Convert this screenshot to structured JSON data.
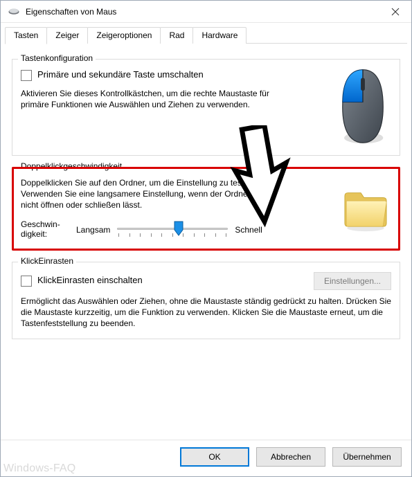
{
  "window": {
    "title": "Eigenschaften von Maus"
  },
  "tabs": [
    {
      "label": "Tasten",
      "active": true
    },
    {
      "label": "Zeiger",
      "active": false
    },
    {
      "label": "Zeigeroptionen",
      "active": false
    },
    {
      "label": "Rad",
      "active": false
    },
    {
      "label": "Hardware",
      "active": false
    }
  ],
  "group_button_config": {
    "legend": "Tastenkonfiguration",
    "checkbox_label": "Primäre und sekundäre Taste umschalten",
    "description": "Aktivieren Sie dieses Kontrollkästchen, um die rechte Maustaste für primäre Funktionen wie Auswählen und Ziehen zu verwenden."
  },
  "group_doubleclick": {
    "legend": "Doppelklickgeschwindigkeit",
    "description": "Doppelklicken Sie auf den Ordner, um die Einstellung zu testen. Verwenden Sie eine langsamere Einstellung, wenn der Ordner sich nicht öffnen oder schließen lässt.",
    "speed_label": "Geschwin­digkeit:",
    "slow": "Langsam",
    "fast": "Schnell",
    "slider": {
      "min": 0,
      "max": 10,
      "value": 5
    }
  },
  "group_clicklock": {
    "legend": "KlickEinrasten",
    "checkbox_label": "KlickEinrasten einschalten",
    "settings_button": "Einstellungen...",
    "description": "Ermöglicht das Auswählen oder Ziehen, ohne die Maustaste ständig gedrückt zu halten. Drücken Sie die Maustaste kurzzeitig, um die Funktion zu verwenden. Klicken Sie die Maustaste erneut, um die Tastenfeststellung zu beenden."
  },
  "footer": {
    "ok": "OK",
    "cancel": "Abbrechen",
    "apply": "Übernehmen"
  },
  "watermark": "Windows-FAQ"
}
